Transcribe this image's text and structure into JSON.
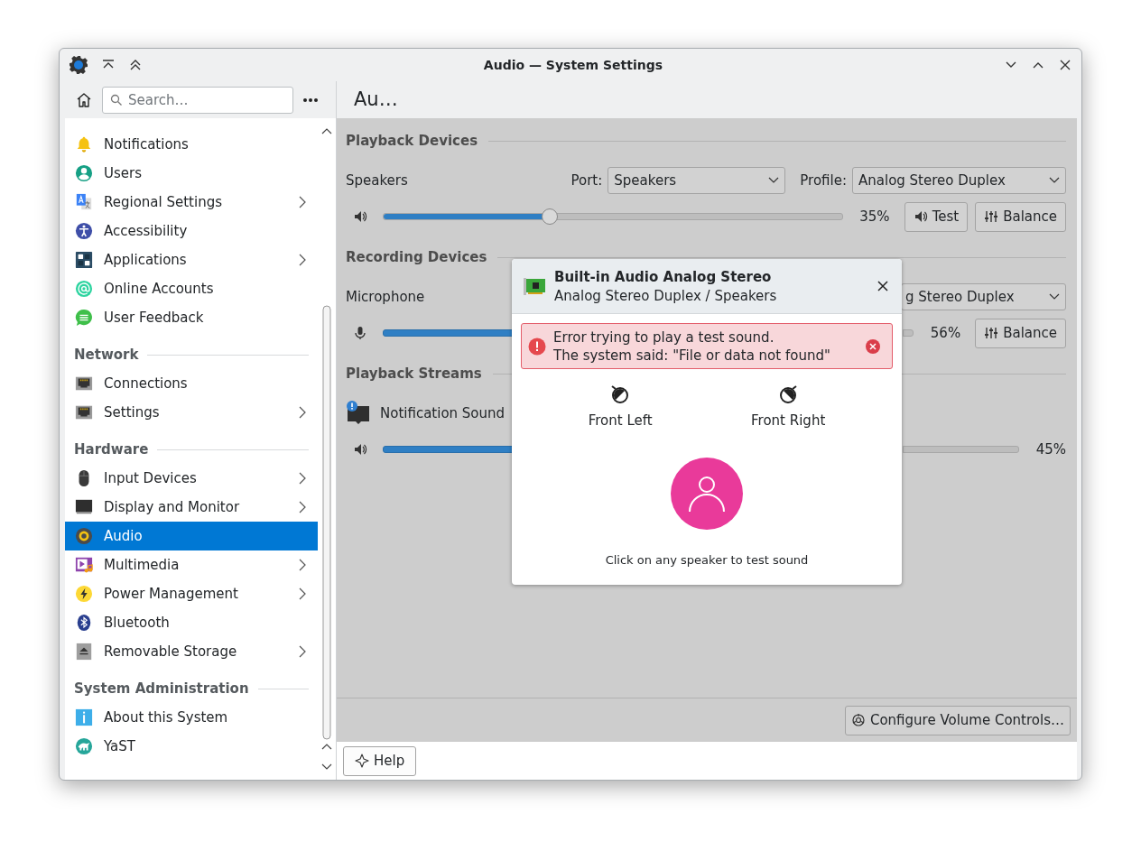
{
  "window": {
    "title": "Audio — System Settings"
  },
  "sidebar": {
    "search": {
      "placeholder": "Search…"
    },
    "sections": [
      {
        "items": [
          {
            "label": "Notifications",
            "has_children": false,
            "selected": false
          },
          {
            "label": "Users",
            "has_children": false,
            "selected": false
          },
          {
            "label": "Regional Settings",
            "has_children": true,
            "selected": false
          },
          {
            "label": "Accessibility",
            "has_children": false,
            "selected": false
          },
          {
            "label": "Applications",
            "has_children": true,
            "selected": false
          },
          {
            "label": "Online Accounts",
            "has_children": false,
            "selected": false
          },
          {
            "label": "User Feedback",
            "has_children": false,
            "selected": false
          }
        ]
      },
      {
        "title": "Network",
        "items": [
          {
            "label": "Connections",
            "has_children": false,
            "selected": false
          },
          {
            "label": "Settings",
            "has_children": true,
            "selected": false
          }
        ]
      },
      {
        "title": "Hardware",
        "items": [
          {
            "label": "Input Devices",
            "has_children": true,
            "selected": false
          },
          {
            "label": "Display and Monitor",
            "has_children": true,
            "selected": false
          },
          {
            "label": "Audio",
            "has_children": false,
            "selected": true
          },
          {
            "label": "Multimedia",
            "has_children": true,
            "selected": false
          },
          {
            "label": "Power Management",
            "has_children": true,
            "selected": false
          },
          {
            "label": "Bluetooth",
            "has_children": false,
            "selected": false
          },
          {
            "label": "Removable Storage",
            "has_children": true,
            "selected": false
          }
        ]
      },
      {
        "title": "System Administration",
        "items": [
          {
            "label": "About this System",
            "has_children": false,
            "selected": false
          },
          {
            "label": "YaST",
            "has_children": false,
            "selected": false
          }
        ]
      }
    ]
  },
  "page": {
    "title": "Au…",
    "sections": [
      {
        "title": "Playback Devices",
        "devices": [
          {
            "kind": "speaker",
            "name": "Speakers",
            "port_label": "Port:",
            "port": "Speakers",
            "profile_label": "Profile:",
            "profile": "Analog Stereo Duplex",
            "level": 0.35,
            "reading": "35%",
            "buttons": [
              {
                "kind": "test",
                "label": "Test"
              },
              {
                "kind": "balance",
                "label": "Balance"
              }
            ]
          }
        ]
      },
      {
        "title": "Recording Devices",
        "devices": [
          {
            "kind": "microphone",
            "name": "Microphone",
            "profile": "g Stereo Duplex",
            "reading": "56%",
            "buttons": [
              {
                "kind": "balance",
                "label": "Balance"
              }
            ]
          }
        ]
      },
      {
        "title": "Playback Streams",
        "devices": [
          {
            "kind": "stream",
            "name": "Notification Sound",
            "reading": "45%"
          }
        ]
      }
    ],
    "configure_button": "Configure Volume Controls…",
    "help_button": "Help"
  },
  "dialog": {
    "title": "Built-in Audio Analog Stereo",
    "subtitle": "Analog Stereo Duplex / Speakers",
    "error": "Error trying to play a test sound.\nThe system said: \"File or data not found\"",
    "speakers": [
      {
        "label": "Front Left"
      },
      {
        "label": "Front Right"
      }
    ],
    "hint": "Click on any speaker to test sound"
  }
}
